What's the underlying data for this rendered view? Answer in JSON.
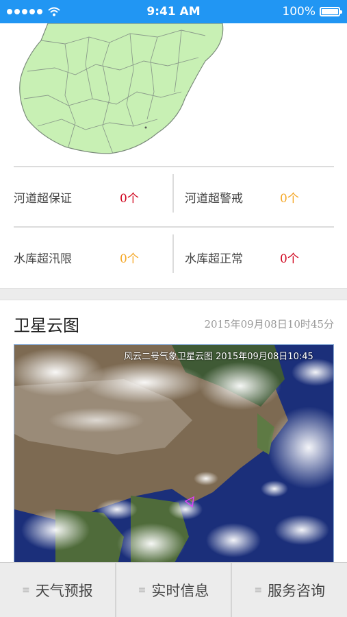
{
  "status_bar": {
    "time": "9:41 AM",
    "battery": "100%",
    "signal_icon": "signal-dots-icon",
    "wifi_icon": "wifi-icon",
    "battery_icon": "battery-icon"
  },
  "stats": [
    [
      {
        "label": "河道超保证",
        "value": "0个",
        "color": "#d0021b"
      },
      {
        "label": "河道超警戒",
        "value": "0个",
        "color": "#f5a623"
      }
    ],
    [
      {
        "label": "水库超汛限",
        "value": "0个",
        "color": "#f5a623"
      },
      {
        "label": "水库超正常",
        "value": "0个",
        "color": "#d0021b"
      }
    ]
  ],
  "satellite": {
    "title": "卫星云图",
    "time": "2015年09月08日10时45分",
    "caption": "风云二号气象卫星云图 2015年09月08日10:45"
  },
  "tabs": [
    {
      "label": "天气预报",
      "icon": "menu-icon"
    },
    {
      "label": "实时信息",
      "icon": "menu-icon"
    },
    {
      "label": "服务咨询",
      "icon": "menu-icon"
    }
  ],
  "colors": {
    "status_bar": "#2196f3",
    "map_fill": "#c8f0b4",
    "danger": "#d0021b",
    "warning": "#f5a623"
  }
}
